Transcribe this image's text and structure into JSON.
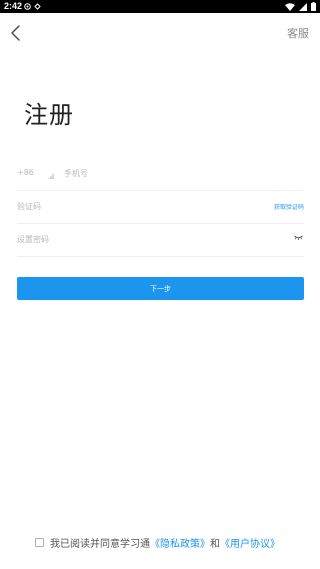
{
  "status_bar": {
    "time": "2:42"
  },
  "header": {
    "service_label": "客服"
  },
  "page": {
    "title": "注册"
  },
  "form": {
    "country_code": "+86",
    "phone_placeholder": "手机号",
    "code_placeholder": "验证码",
    "get_code_label": "获取验证码",
    "password_placeholder": "设置密码"
  },
  "actions": {
    "next_label": "下一步"
  },
  "agreement": {
    "prefix": "我已阅读并同意学习通",
    "privacy_link": "《隐私政策》",
    "conjunction": "和",
    "user_agreement_link": "《用户协议》"
  },
  "colors": {
    "accent": "#1c95ee",
    "status_bar": "#000000"
  },
  "icons": {
    "back": "chevron-left-icon",
    "eye": "eye-closed-icon",
    "dropdown": "triangle-icon",
    "wifi": "wifi-icon",
    "battery": "battery-icon"
  }
}
